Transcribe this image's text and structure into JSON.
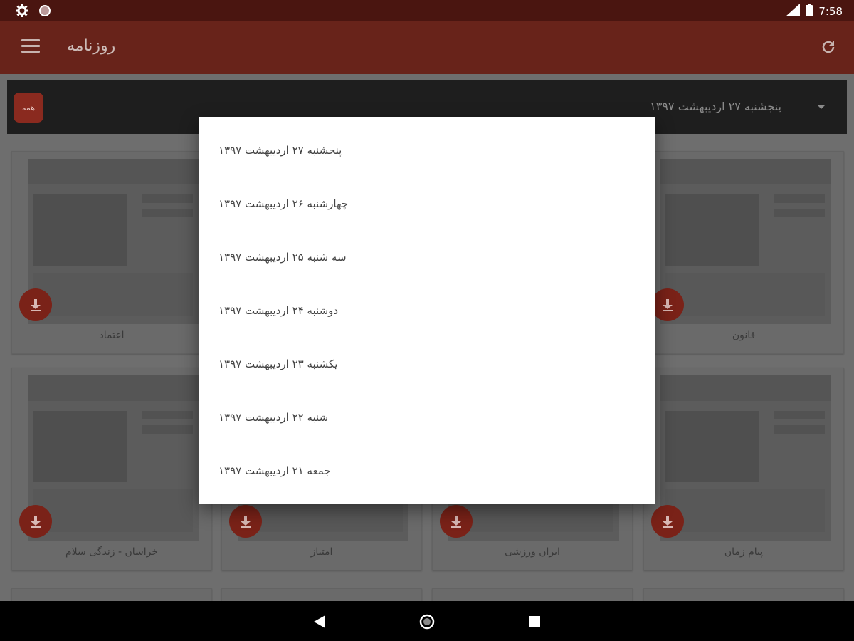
{
  "status_bar": {
    "time": "7:58"
  },
  "app_bar": {
    "title": "روزنامه"
  },
  "filter_bar": {
    "all_button": "همه",
    "selected_date": "پنجشنبه ۲۷ اردیبهشت ۱۳۹۷"
  },
  "cards": [
    {
      "name": "اعتماد"
    },
    {
      "name": "قانون"
    },
    {
      "name": "خراسان - زندگی سلام"
    },
    {
      "name": "امتیاز"
    },
    {
      "name": "ایران ورزشی"
    },
    {
      "name": "پیام زمان"
    }
  ],
  "dialog": {
    "options": [
      "پنجشنبه ۲۷ اردیبهشت ۱۳۹۷",
      "چهارشنبه ۲۶ اردیبهشت ۱۳۹۷",
      "سه شنبه ۲۵ اردیبهشت ۱۳۹۷",
      "دوشنبه ۲۴ اردیبهشت ۱۳۹۷",
      "یکشنبه ۲۳ اردیبهشت ۱۳۹۷",
      "شنبه ۲۲ اردیبهشت ۱۳۹۷",
      "جمعه ۲۱ اردیبهشت ۱۳۹۷"
    ]
  },
  "colors": {
    "app_bar": "#68231a",
    "status_bar": "#4a1510",
    "accent": "#c0392b"
  },
  "icons": {
    "status_left": [
      "gear-icon",
      "circle-icon"
    ],
    "status_right": [
      "signal-icon",
      "battery-icon"
    ],
    "app_bar": [
      "hamburger-menu-icon",
      "refresh-icon"
    ],
    "cards": "download-icon",
    "nav": [
      "back-icon",
      "home-icon",
      "recents-icon"
    ]
  }
}
